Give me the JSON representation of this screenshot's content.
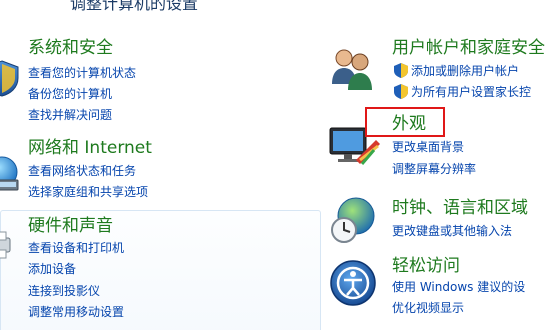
{
  "header": {
    "title_cut": "调整计算机的设置"
  },
  "left": {
    "system_security": {
      "title": "系统和安全",
      "links": [
        "查看您的计算机状态",
        "备份您的计算机",
        "查找并解决问题"
      ]
    },
    "network_internet": {
      "title": "网络和 Internet",
      "links": [
        "查看网络状态和任务",
        "选择家庭组和共享选项"
      ]
    },
    "hardware_sound": {
      "title": "硬件和声音",
      "links": [
        "查看设备和打印机",
        "添加设备",
        "连接到投影仪",
        "调整常用移动设置"
      ]
    }
  },
  "right": {
    "user_accounts": {
      "title": "用户帐户和家庭安全",
      "links": [
        "添加或删除用户帐户",
        "为所有用户设置家长控"
      ]
    },
    "appearance": {
      "title": "外观",
      "links": [
        "更改桌面背景",
        "调整屏幕分辨率"
      ]
    },
    "clock_language": {
      "title": "时钟、语言和区域",
      "links": [
        "更改键盘或其他输入法"
      ]
    },
    "ease_of_access": {
      "title": "轻松访问",
      "links": [
        "使用 Windows 建议的设",
        "优化视频显示"
      ]
    }
  },
  "colors": {
    "category_title": "#1e7a1e",
    "link": "#0645ad",
    "highlight_border": "#e01818"
  }
}
